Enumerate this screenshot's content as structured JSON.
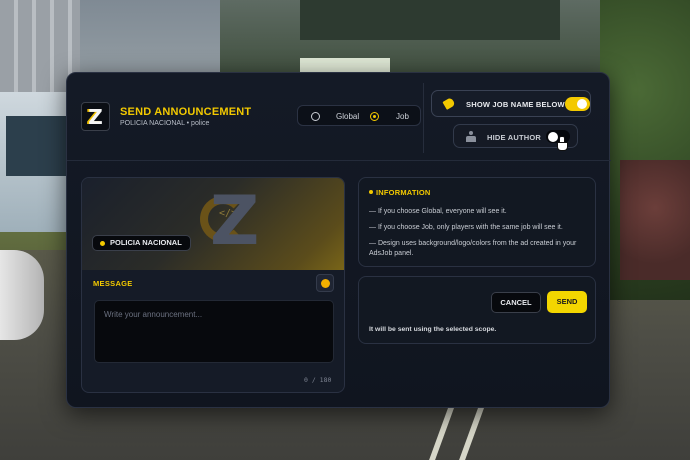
{
  "header": {
    "title": "SEND ANNOUNCEMENT",
    "subtitle": "POLICIA NACIONAL • police"
  },
  "scope": {
    "options": [
      {
        "label": "Global",
        "selected": false
      },
      {
        "label": "Job",
        "selected": true
      }
    ]
  },
  "toggles": {
    "show_job_name": {
      "label": "SHOW JOB NAME BELOW",
      "on": true
    },
    "hide_author": {
      "label": "HIDE AUTHOR",
      "on": false
    }
  },
  "composer": {
    "job_badge": "POLICIA NACIONAL",
    "message_label": "MESSAGE",
    "placeholder": "Write your announcement...",
    "char_count": "0 / 180"
  },
  "info": {
    "title": "INFORMATION",
    "lines": [
      "— If you choose Global, everyone will see it.",
      "— If you choose Job, only players with the same job will see it.",
      "— Design uses background/logo/colors from the ad created in your AdsJob panel."
    ]
  },
  "actions": {
    "cancel_label": "CANCEL",
    "send_label": "SEND",
    "note": "It will be sent using the selected scope."
  },
  "colors": {
    "accent": "#f3c900",
    "panel_bg": "#141a26"
  }
}
